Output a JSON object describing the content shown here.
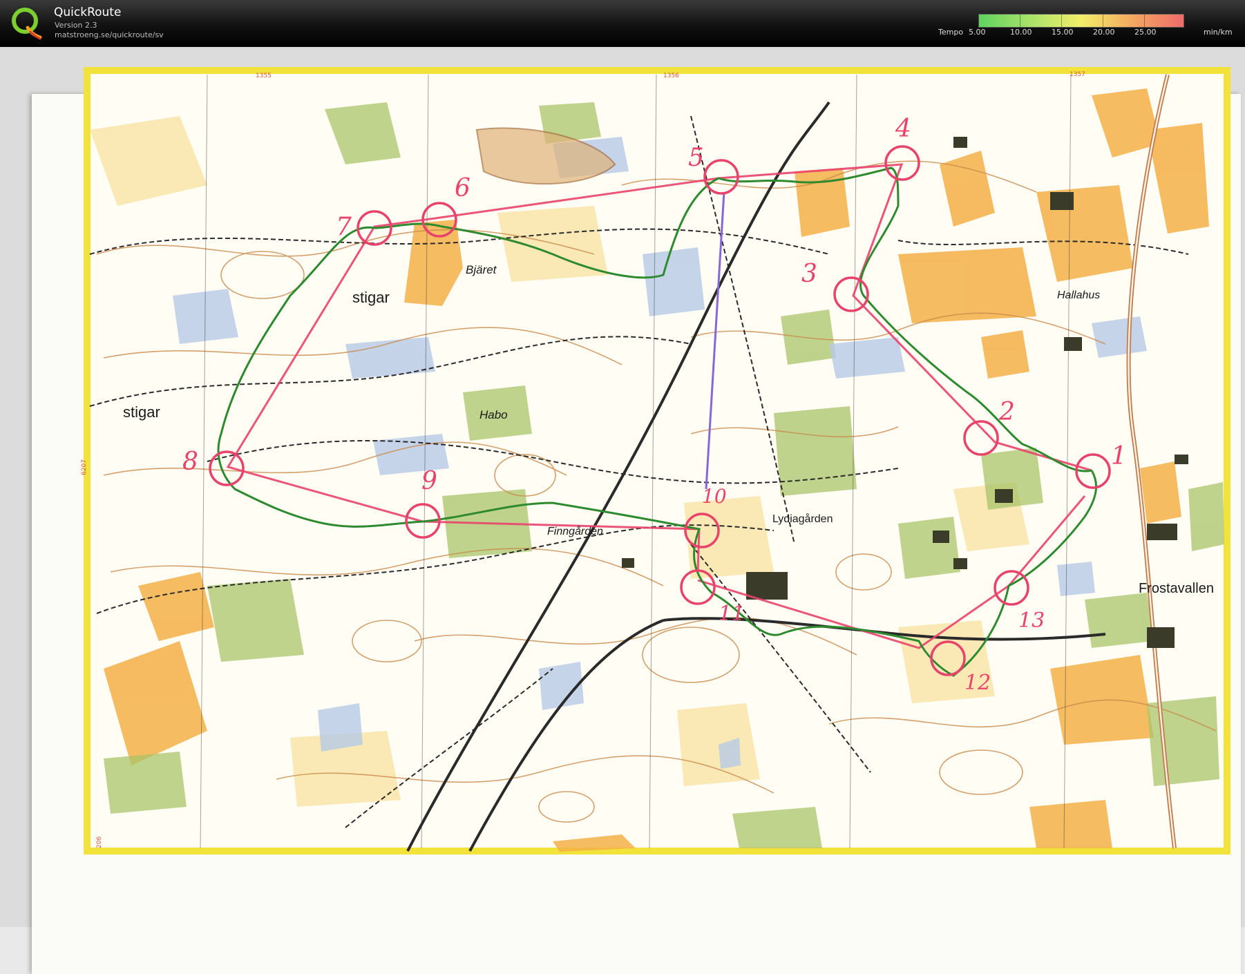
{
  "app": {
    "name": "QuickRoute",
    "version": "Version 2.3",
    "url": "matstroeng.se/quickroute/sv",
    "logo_letter": "Q"
  },
  "legend": {
    "label": "Tempo",
    "ticks": [
      "5.00",
      "10.00",
      "15.00",
      "20.00",
      "25.00"
    ],
    "unit": "min/km",
    "colors": [
      "#5fd35f",
      "#a9e26a",
      "#f2ee6a",
      "#f5b060",
      "#f06a6a"
    ]
  },
  "map": {
    "place_names": [
      "Bjäret",
      "stigar",
      "stigar",
      "Habo",
      "Finngården",
      "Lydiagården",
      "Hallahus",
      "Frostavallen"
    ],
    "grid_labels": [
      "1355",
      "1356",
      "1357",
      "6207",
      "206"
    ],
    "controls": [
      "1",
      "2",
      "3",
      "4",
      "5",
      "6",
      "7",
      "8",
      "9",
      "10",
      "11",
      "12",
      "13"
    ],
    "colors": {
      "course": "#e8436b",
      "route": "#2e8a2e",
      "open_land": "#f5b048",
      "green": "#a9c46a",
      "water": "#b7c9e6",
      "contour": "#c98a4a",
      "border": "#f2e23a",
      "path": "#2a2a2a"
    }
  }
}
